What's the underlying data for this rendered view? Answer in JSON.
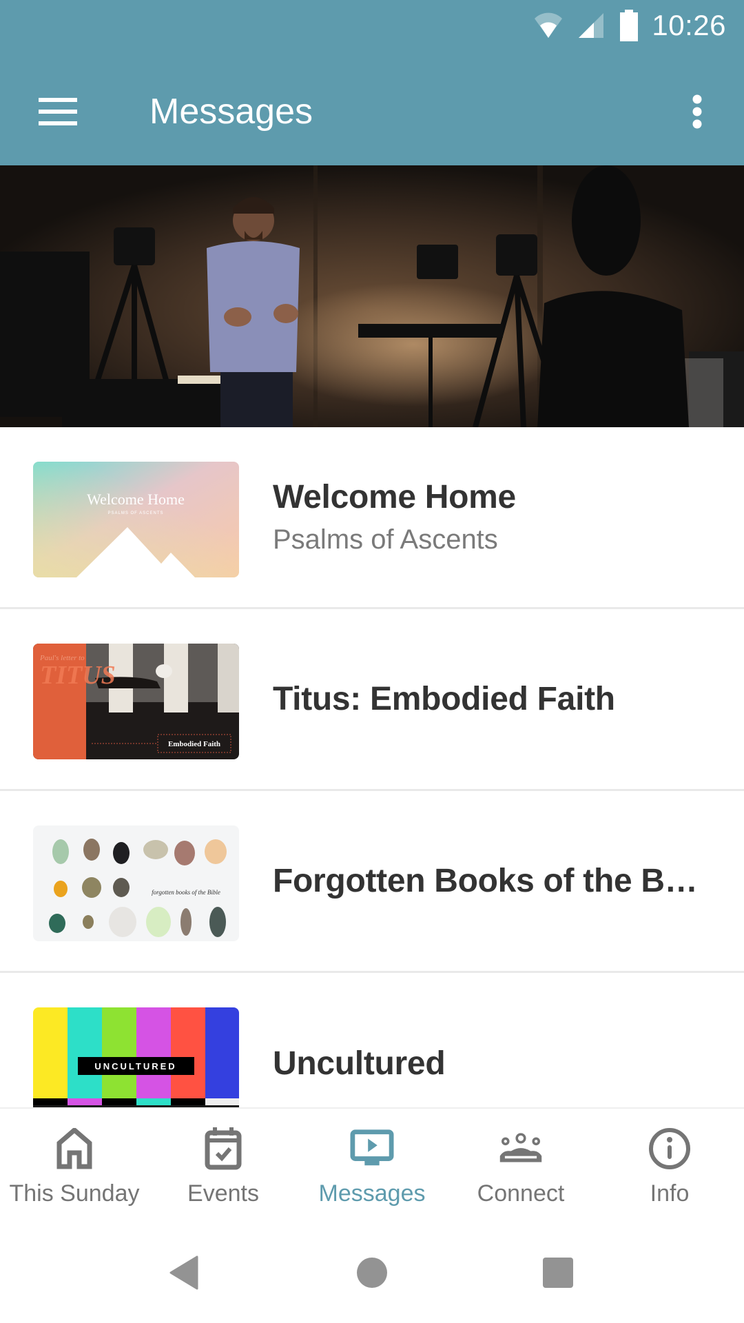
{
  "status_bar": {
    "time": "10:26",
    "icons": [
      "wifi-icon",
      "cell-signal-icon",
      "battery-icon"
    ]
  },
  "app_bar": {
    "title": "Messages",
    "menu_icon": "hamburger-menu-icon",
    "overflow_icon": "more-vert-icon",
    "color": "#5E9BAD"
  },
  "hero": {
    "description": "Speaker presenting in a studio with cameras on tripods"
  },
  "series": [
    {
      "title": "Welcome Home",
      "subtitle": "Psalms of Ascents",
      "thumb": {
        "heading": "Welcome Home",
        "caption": "PSALMS OF ASCENTS"
      }
    },
    {
      "title": "Titus: Embodied Faith",
      "subtitle": "",
      "thumb": {
        "overline": "Paul's letter to",
        "heading": "TITUS",
        "caption": "Embodied Faith"
      }
    },
    {
      "title": "Forgotten Books of the Bi…",
      "subtitle": "",
      "thumb": {
        "caption": "forgotten books of the Bible"
      }
    },
    {
      "title": "Uncultured",
      "subtitle": "",
      "thumb": {
        "caption": "UNCULTURED"
      }
    }
  ],
  "bottom_nav": {
    "active_color": "#5E9BAD",
    "inactive_color": "#757575",
    "items": [
      {
        "label": "This Sunday",
        "icon": "home-icon",
        "active": false
      },
      {
        "label": "Events",
        "icon": "calendar-check-icon",
        "active": false
      },
      {
        "label": "Messages",
        "icon": "tv-play-icon",
        "active": true
      },
      {
        "label": "Connect",
        "icon": "group-icon",
        "active": false
      },
      {
        "label": "Info",
        "icon": "info-icon",
        "active": false
      }
    ]
  },
  "system_nav": {
    "buttons": [
      "back-icon",
      "home-circle-icon",
      "recents-icon"
    ]
  }
}
